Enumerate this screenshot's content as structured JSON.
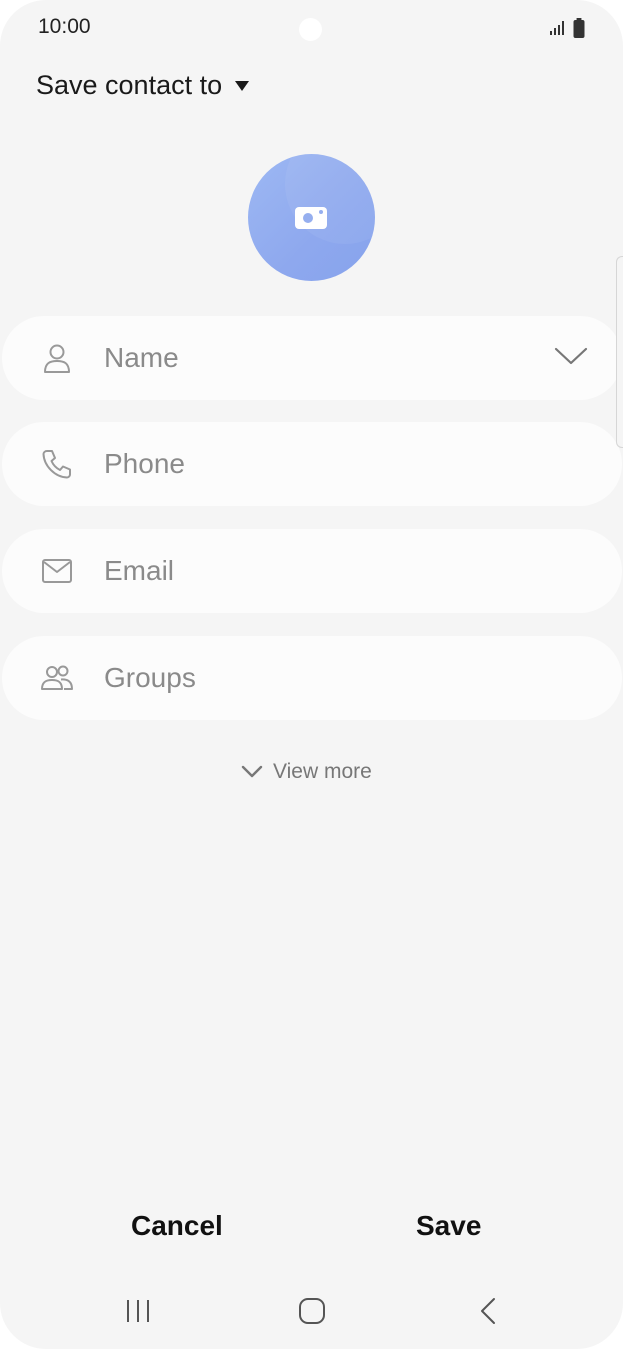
{
  "status_bar": {
    "time": "10:00",
    "icons": [
      "signal-icon",
      "battery-icon"
    ]
  },
  "header": {
    "save_to_label": "Save contact to",
    "dropdown_icon": "caret-down-icon"
  },
  "avatar": {
    "icon": "camera-icon",
    "color": "#90abef"
  },
  "fields": [
    {
      "icon": "person-icon",
      "placeholder": "Name",
      "expandable": true
    },
    {
      "icon": "phone-icon",
      "placeholder": "Phone"
    },
    {
      "icon": "email-icon",
      "placeholder": "Email"
    },
    {
      "icon": "groups-icon",
      "placeholder": "Groups"
    }
  ],
  "view_more": {
    "label": "View more",
    "icon": "chevron-down-icon"
  },
  "actions": {
    "cancel_label": "Cancel",
    "save_label": "Save"
  },
  "nav_bar": {
    "icons": [
      "recent-apps-icon",
      "home-icon",
      "back-icon"
    ]
  }
}
